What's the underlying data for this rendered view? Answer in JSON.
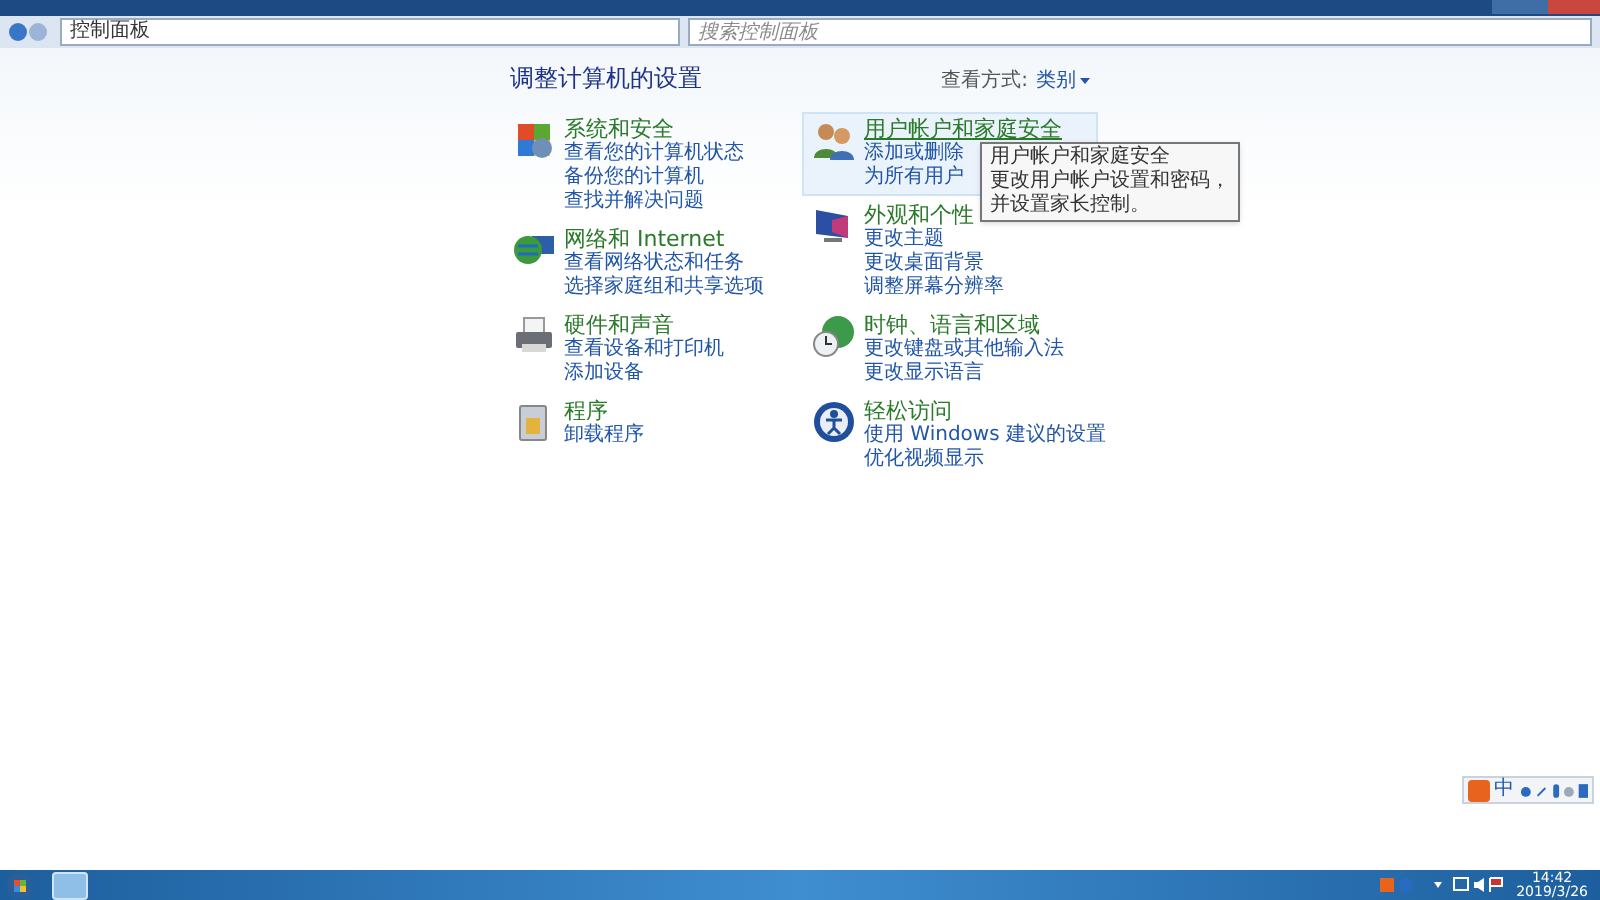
{
  "address_bar": {
    "breadcrumb": "控制面板",
    "search": {
      "placeholder": "搜索控制面板"
    }
  },
  "heading": "调整计算机的设置",
  "view_by": {
    "label": "查看方式:",
    "value": "类别"
  },
  "columns": [
    {
      "categories": [
        {
          "title": "系统和安全",
          "kind": "shield",
          "hovered": false,
          "links": [
            "查看您的计算机状态",
            "备份您的计算机",
            "查找并解决问题"
          ]
        },
        {
          "title": "网络和 Internet",
          "kind": "network",
          "hovered": false,
          "links": [
            "查看网络状态和任务",
            "选择家庭组和共享选项"
          ]
        },
        {
          "title": "硬件和声音",
          "kind": "printer",
          "hovered": false,
          "links": [
            "查看设备和打印机",
            "添加设备"
          ]
        },
        {
          "title": "程序",
          "kind": "programs",
          "hovered": false,
          "links": [
            "卸载程序"
          ]
        }
      ]
    },
    {
      "categories": [
        {
          "title": "用户帐户和家庭安全",
          "kind": "users",
          "hovered": true,
          "links": [
            "添加或删除",
            "为所有用户"
          ]
        },
        {
          "title": "外观和个性",
          "kind": "display",
          "hovered": false,
          "links": [
            "更改主题",
            "更改桌面背景",
            "调整屏幕分辨率"
          ]
        },
        {
          "title": "时钟、语言和区域",
          "kind": "clock",
          "hovered": false,
          "links": [
            "更改键盘或其他输入法",
            "更改显示语言"
          ]
        },
        {
          "title": "轻松访问",
          "kind": "access",
          "hovered": false,
          "links": [
            "使用 Windows 建议的设置",
            "优化视频显示"
          ]
        }
      ]
    }
  ],
  "tooltip": {
    "title": "用户帐户和家庭安全",
    "text": "更改用户帐户设置和密码，并设置家长控制。"
  },
  "ime_bar": {
    "mode": "中"
  },
  "taskbar": {
    "time": "14:42",
    "date": "2019/3/26"
  }
}
